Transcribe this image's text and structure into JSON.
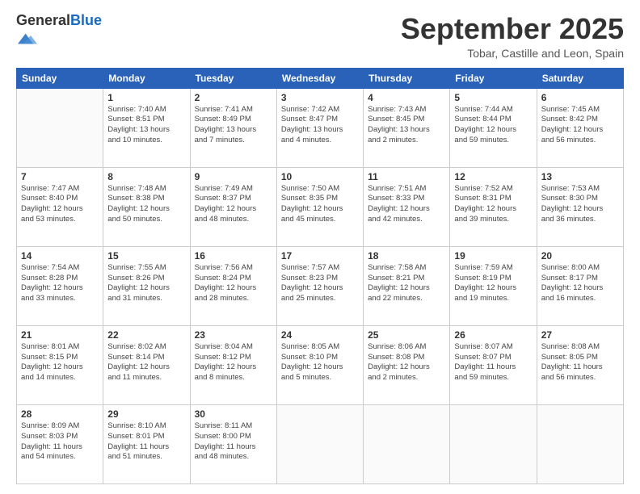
{
  "logo": {
    "general": "General",
    "blue": "Blue"
  },
  "title": "September 2025",
  "location": "Tobar, Castille and Leon, Spain",
  "days_header": [
    "Sunday",
    "Monday",
    "Tuesday",
    "Wednesday",
    "Thursday",
    "Friday",
    "Saturday"
  ],
  "weeks": [
    [
      {
        "day": "",
        "info": ""
      },
      {
        "day": "1",
        "info": "Sunrise: 7:40 AM\nSunset: 8:51 PM\nDaylight: 13 hours\nand 10 minutes."
      },
      {
        "day": "2",
        "info": "Sunrise: 7:41 AM\nSunset: 8:49 PM\nDaylight: 13 hours\nand 7 minutes."
      },
      {
        "day": "3",
        "info": "Sunrise: 7:42 AM\nSunset: 8:47 PM\nDaylight: 13 hours\nand 4 minutes."
      },
      {
        "day": "4",
        "info": "Sunrise: 7:43 AM\nSunset: 8:45 PM\nDaylight: 13 hours\nand 2 minutes."
      },
      {
        "day": "5",
        "info": "Sunrise: 7:44 AM\nSunset: 8:44 PM\nDaylight: 12 hours\nand 59 minutes."
      },
      {
        "day": "6",
        "info": "Sunrise: 7:45 AM\nSunset: 8:42 PM\nDaylight: 12 hours\nand 56 minutes."
      }
    ],
    [
      {
        "day": "7",
        "info": "Sunrise: 7:47 AM\nSunset: 8:40 PM\nDaylight: 12 hours\nand 53 minutes."
      },
      {
        "day": "8",
        "info": "Sunrise: 7:48 AM\nSunset: 8:38 PM\nDaylight: 12 hours\nand 50 minutes."
      },
      {
        "day": "9",
        "info": "Sunrise: 7:49 AM\nSunset: 8:37 PM\nDaylight: 12 hours\nand 48 minutes."
      },
      {
        "day": "10",
        "info": "Sunrise: 7:50 AM\nSunset: 8:35 PM\nDaylight: 12 hours\nand 45 minutes."
      },
      {
        "day": "11",
        "info": "Sunrise: 7:51 AM\nSunset: 8:33 PM\nDaylight: 12 hours\nand 42 minutes."
      },
      {
        "day": "12",
        "info": "Sunrise: 7:52 AM\nSunset: 8:31 PM\nDaylight: 12 hours\nand 39 minutes."
      },
      {
        "day": "13",
        "info": "Sunrise: 7:53 AM\nSunset: 8:30 PM\nDaylight: 12 hours\nand 36 minutes."
      }
    ],
    [
      {
        "day": "14",
        "info": "Sunrise: 7:54 AM\nSunset: 8:28 PM\nDaylight: 12 hours\nand 33 minutes."
      },
      {
        "day": "15",
        "info": "Sunrise: 7:55 AM\nSunset: 8:26 PM\nDaylight: 12 hours\nand 31 minutes."
      },
      {
        "day": "16",
        "info": "Sunrise: 7:56 AM\nSunset: 8:24 PM\nDaylight: 12 hours\nand 28 minutes."
      },
      {
        "day": "17",
        "info": "Sunrise: 7:57 AM\nSunset: 8:23 PM\nDaylight: 12 hours\nand 25 minutes."
      },
      {
        "day": "18",
        "info": "Sunrise: 7:58 AM\nSunset: 8:21 PM\nDaylight: 12 hours\nand 22 minutes."
      },
      {
        "day": "19",
        "info": "Sunrise: 7:59 AM\nSunset: 8:19 PM\nDaylight: 12 hours\nand 19 minutes."
      },
      {
        "day": "20",
        "info": "Sunrise: 8:00 AM\nSunset: 8:17 PM\nDaylight: 12 hours\nand 16 minutes."
      }
    ],
    [
      {
        "day": "21",
        "info": "Sunrise: 8:01 AM\nSunset: 8:15 PM\nDaylight: 12 hours\nand 14 minutes."
      },
      {
        "day": "22",
        "info": "Sunrise: 8:02 AM\nSunset: 8:14 PM\nDaylight: 12 hours\nand 11 minutes."
      },
      {
        "day": "23",
        "info": "Sunrise: 8:04 AM\nSunset: 8:12 PM\nDaylight: 12 hours\nand 8 minutes."
      },
      {
        "day": "24",
        "info": "Sunrise: 8:05 AM\nSunset: 8:10 PM\nDaylight: 12 hours\nand 5 minutes."
      },
      {
        "day": "25",
        "info": "Sunrise: 8:06 AM\nSunset: 8:08 PM\nDaylight: 12 hours\nand 2 minutes."
      },
      {
        "day": "26",
        "info": "Sunrise: 8:07 AM\nSunset: 8:07 PM\nDaylight: 11 hours\nand 59 minutes."
      },
      {
        "day": "27",
        "info": "Sunrise: 8:08 AM\nSunset: 8:05 PM\nDaylight: 11 hours\nand 56 minutes."
      }
    ],
    [
      {
        "day": "28",
        "info": "Sunrise: 8:09 AM\nSunset: 8:03 PM\nDaylight: 11 hours\nand 54 minutes."
      },
      {
        "day": "29",
        "info": "Sunrise: 8:10 AM\nSunset: 8:01 PM\nDaylight: 11 hours\nand 51 minutes."
      },
      {
        "day": "30",
        "info": "Sunrise: 8:11 AM\nSunset: 8:00 PM\nDaylight: 11 hours\nand 48 minutes."
      },
      {
        "day": "",
        "info": ""
      },
      {
        "day": "",
        "info": ""
      },
      {
        "day": "",
        "info": ""
      },
      {
        "day": "",
        "info": ""
      }
    ]
  ]
}
